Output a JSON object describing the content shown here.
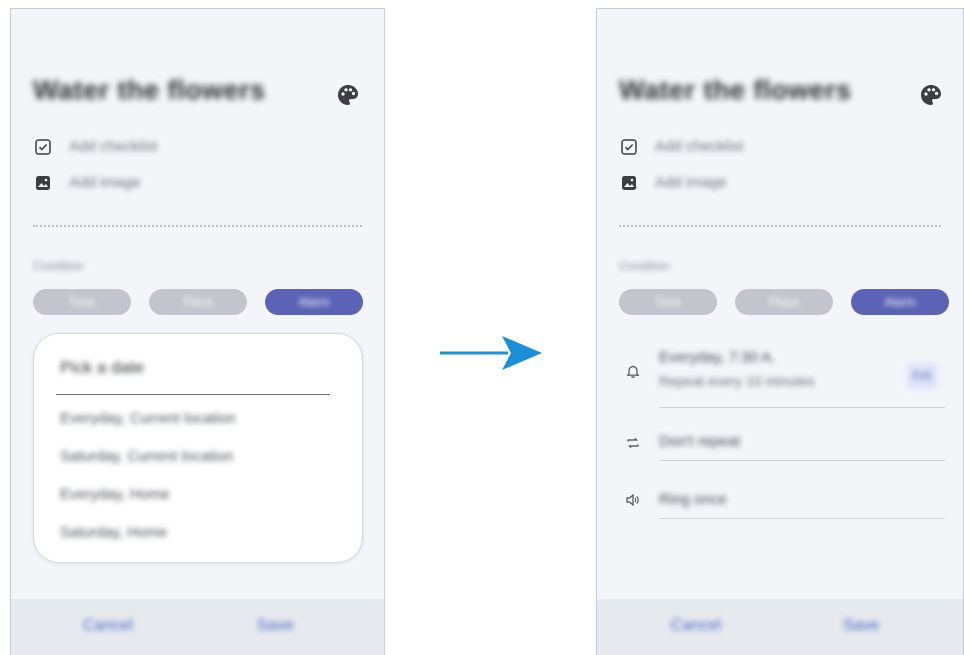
{
  "reminder": {
    "title": "Water the flowers",
    "rows": [
      {
        "icon": "checkbox-icon",
        "label": "Add checklist"
      },
      {
        "icon": "image-icon",
        "label": "Add image"
      }
    ],
    "condition_label": "Condition",
    "chips": [
      "Time",
      "Place",
      "Alarm"
    ]
  },
  "popup": {
    "title": "Pick a date",
    "items": [
      "Everyday, Current location",
      "Saturday, Current location",
      "Everyday, Home",
      "Saturday, Home"
    ]
  },
  "alarm": {
    "time_line1": "Everyday, 7:30 A.",
    "time_line2": "Repeat every 10 minutes",
    "edit_label": "Edit",
    "repeat_label": "Don't repeat",
    "sound_label": "Ring once"
  },
  "buttons": {
    "cancel": "Cancel",
    "save": "Save"
  },
  "colors": {
    "accent": "#5a63b5",
    "arrow": "#1a8fd8",
    "link": "#4d64c9"
  }
}
